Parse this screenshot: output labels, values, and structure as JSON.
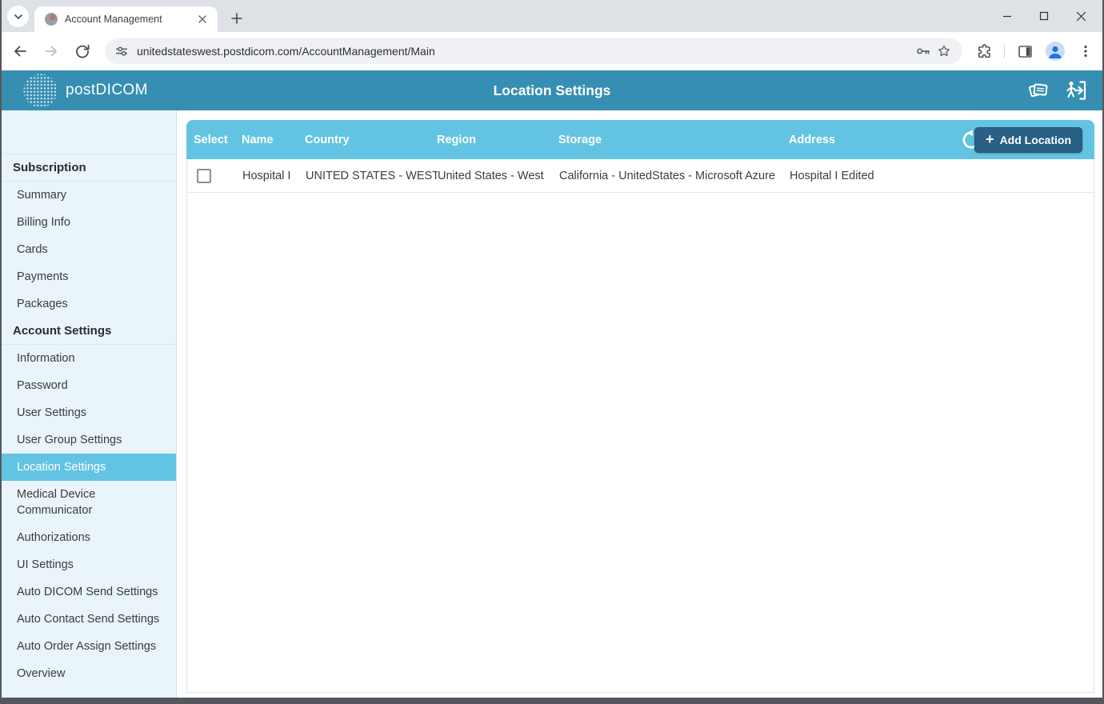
{
  "browser": {
    "tab_title": "Account Management",
    "url": "unitedstateswest.postdicom.com/AccountManagement/Main"
  },
  "header": {
    "logo_text": "postDICOM",
    "title": "Location Settings"
  },
  "sidebar": {
    "selected": "Location Settings",
    "sections": [
      {
        "label": "Subscription",
        "items": [
          "Summary",
          "Billing Info",
          "Cards",
          "Payments",
          "Packages"
        ]
      },
      {
        "label": "Account Settings",
        "items": [
          "Information",
          "Password",
          "User Settings",
          "User Group Settings",
          "Location Settings",
          "Medical Device Communicator",
          "Authorizations",
          "UI Settings",
          "Auto DICOM Send Settings",
          "Auto Contact Send Settings",
          "Auto Order Assign Settings",
          "Overview"
        ]
      }
    ]
  },
  "table": {
    "columns": [
      "Select",
      "Name",
      "Country",
      "Region",
      "Storage",
      "Address"
    ],
    "add_button_plus": "+",
    "add_button_label": "Add Location",
    "rows": [
      {
        "selected": false,
        "name": "Hospital I",
        "country": "UNITED STATES - WEST",
        "region": "United States - West",
        "storage": "California - UnitedStates - Microsoft Azure",
        "address": "Hospital I Edited"
      }
    ]
  },
  "colors": {
    "header_teal": "#368fb2",
    "accent_blue": "#62c4e2",
    "button_dark_blue": "#2a5f86",
    "sidebar_bg": "#e9f4fb"
  }
}
